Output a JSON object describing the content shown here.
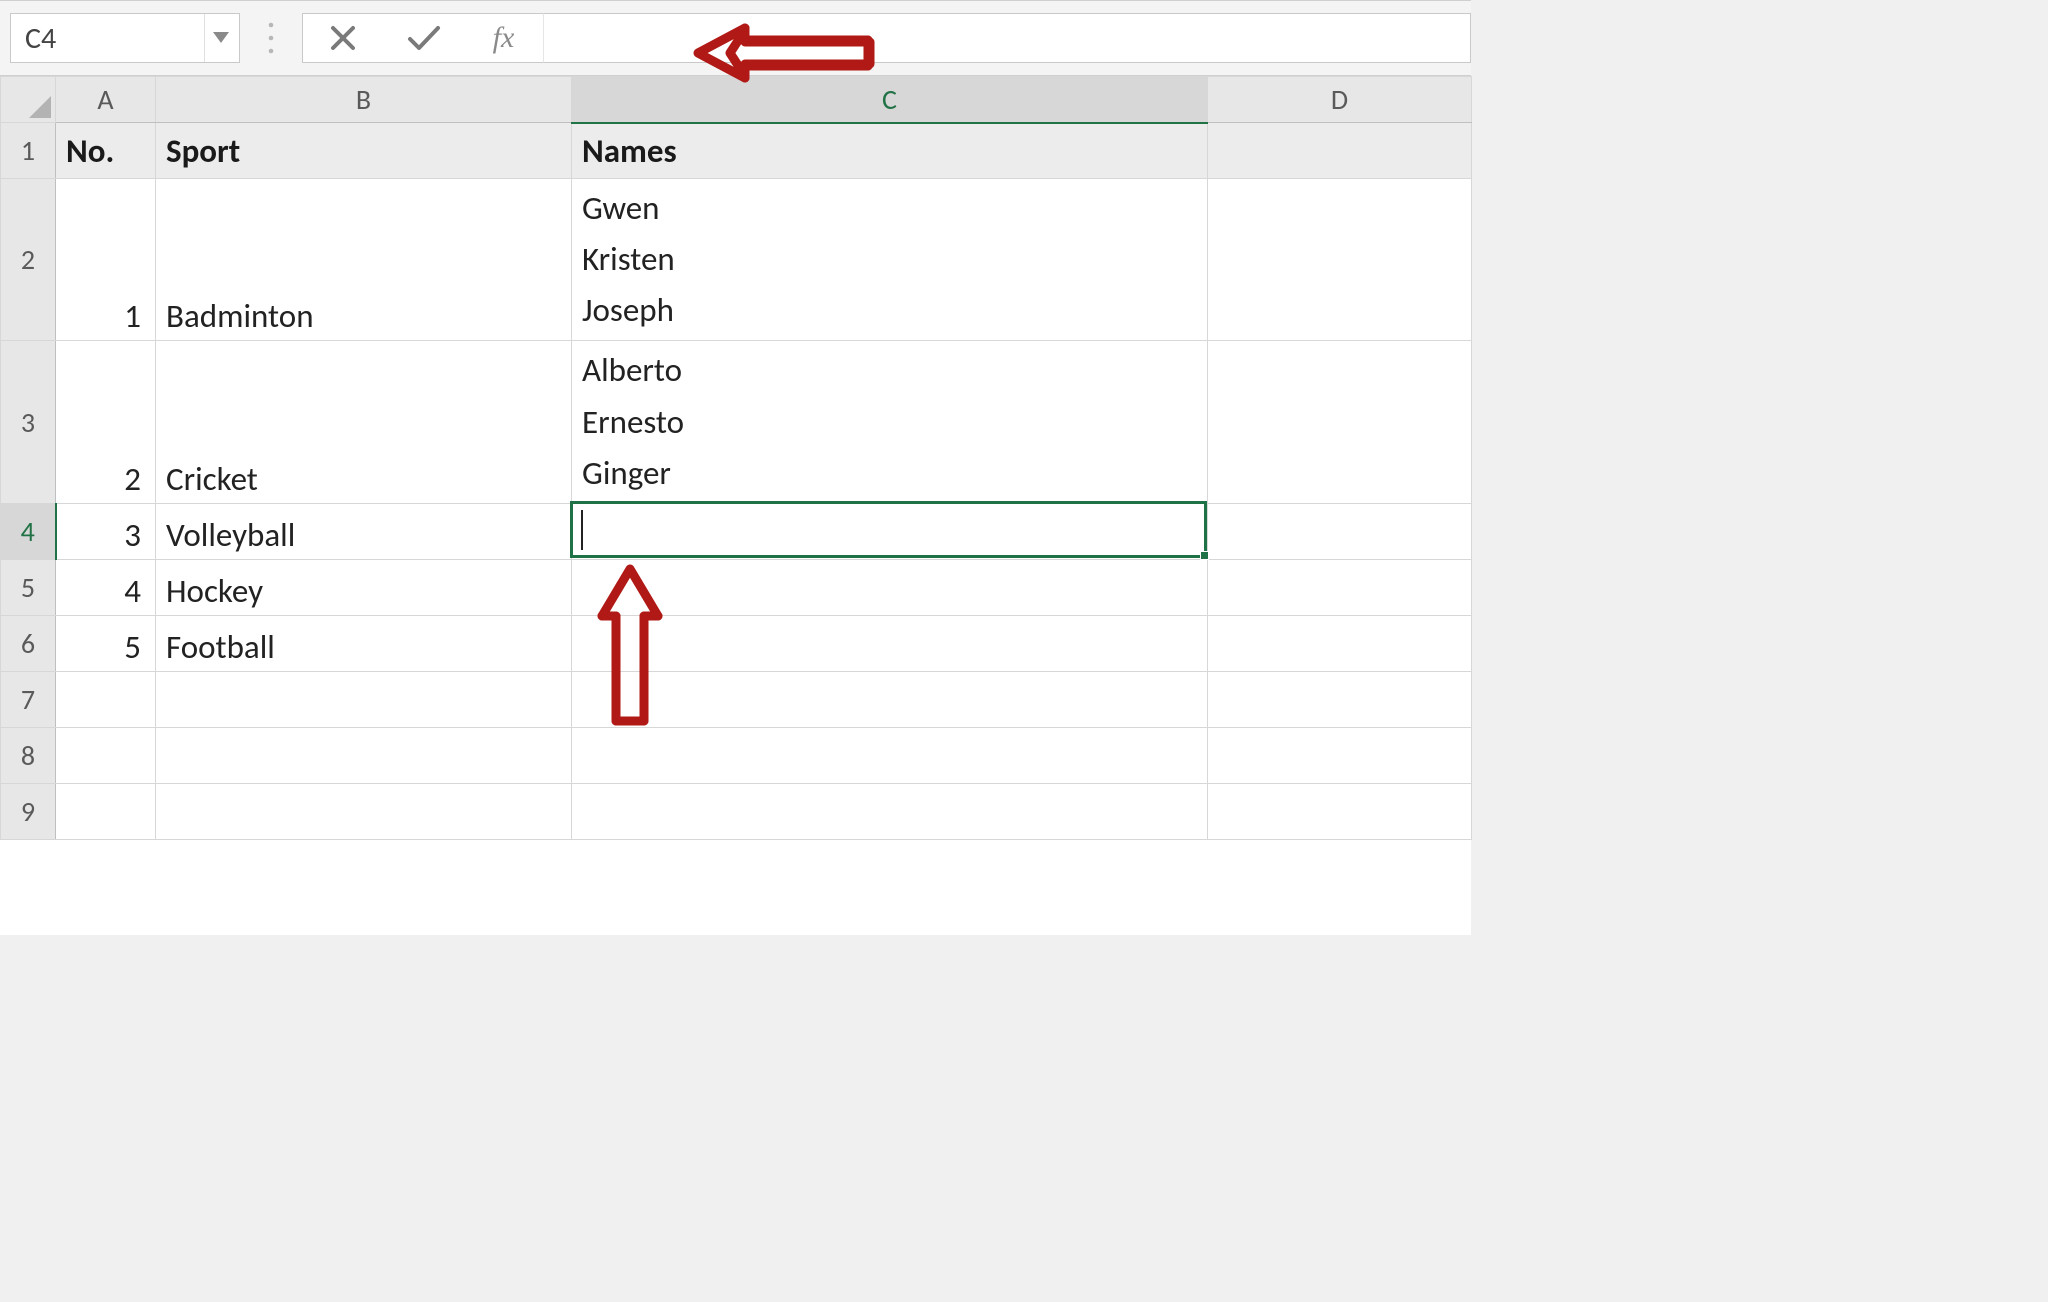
{
  "formula_bar": {
    "name_box_value": "C4",
    "formula_value": "",
    "cancel_icon": "cancel-icon",
    "enter_icon": "enter-icon",
    "fx_label": "fx"
  },
  "columns": [
    "A",
    "B",
    "C",
    "D"
  ],
  "rows": [
    "1",
    "2",
    "3",
    "4",
    "5",
    "6",
    "7",
    "8",
    "9"
  ],
  "active": {
    "col": "C",
    "row": "4"
  },
  "headers": {
    "A": "No.",
    "B": "Sport",
    "C": "Names"
  },
  "data": {
    "2": {
      "A": "1",
      "B": "Badminton",
      "C": "Gwen\nKristen\nJoseph"
    },
    "3": {
      "A": "2",
      "B": "Cricket",
      "C": "Alberto\nErnesto\nGinger"
    },
    "4": {
      "A": "3",
      "B": "Volleyball",
      "C": ""
    },
    "5": {
      "A": "4",
      "B": "Hockey",
      "C": ""
    },
    "6": {
      "A": "5",
      "B": "Football",
      "C": ""
    }
  },
  "annotations": {
    "arrow_formula_bar": "points-left",
    "arrow_cell_c4": "points-up"
  }
}
